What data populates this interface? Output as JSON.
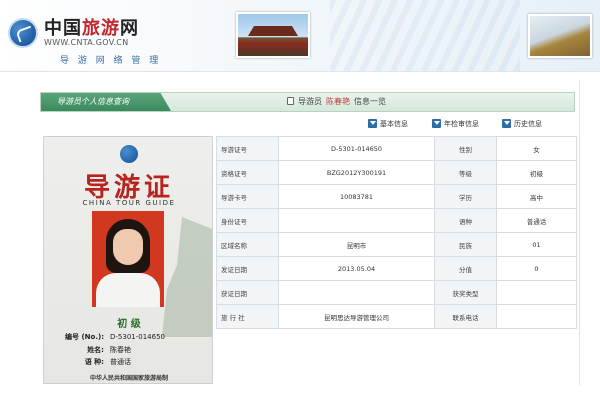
{
  "header": {
    "brand_pre": "中国",
    "brand_accent": "旅游",
    "brand_post": "网",
    "url": "WWW.CNTA.GOV.CN",
    "subtitle": "导 游 网 络 管 理"
  },
  "titlebar": {
    "title": "导游员个人信息查询",
    "crumb_prefix": "导游员",
    "crumb_name": "陈春艳",
    "crumb_suffix": "信息一览"
  },
  "actions": {
    "basic": "基本信息",
    "check": "年检审信息",
    "history": "历史信息"
  },
  "card": {
    "title": "导游证",
    "subtitle": "CHINA TOUR GUIDE",
    "level": "初 级",
    "no_label": "编号 (No.):",
    "no_value": "D-5301-014650",
    "name_label": "姓名:",
    "name_value": "陈春艳",
    "lang_label": "语 种:",
    "lang_value": "普通话",
    "issuer": "中华人民共和国国家旅游局制"
  },
  "info": {
    "rows": [
      {
        "k1": "导游证号",
        "v1": "D-5301-014650",
        "k2": "性别",
        "v2": "女"
      },
      {
        "k1": "资格证号",
        "v1": "BZG2012Y300191",
        "k2": "等级",
        "v2": "初级"
      },
      {
        "k1": "导游卡号",
        "v1": "10083781",
        "k2": "学历",
        "v2": "高中"
      },
      {
        "k1": "身份证号",
        "v1": "",
        "k2": "语种",
        "v2": "普通话"
      },
      {
        "k1": "区域名称",
        "v1": "昆明市",
        "k2": "民族",
        "v2": "01"
      },
      {
        "k1": "发证日期",
        "v1": "2013.05.04",
        "k2": "分值",
        "v2": "0"
      },
      {
        "k1": "获证日期",
        "v1": "",
        "k2": "获奖类型",
        "v2": ""
      },
      {
        "k1": "旅 行 社",
        "v1": "昆明思达导游管理公司",
        "k2": "联系电话",
        "v2": ""
      }
    ]
  },
  "colors": {
    "titlebar_green": "#3a8a5d",
    "card_title_red": "#b8231e",
    "action_icon_blue": "#2d6ea8",
    "photo_background": "#d2371f"
  }
}
